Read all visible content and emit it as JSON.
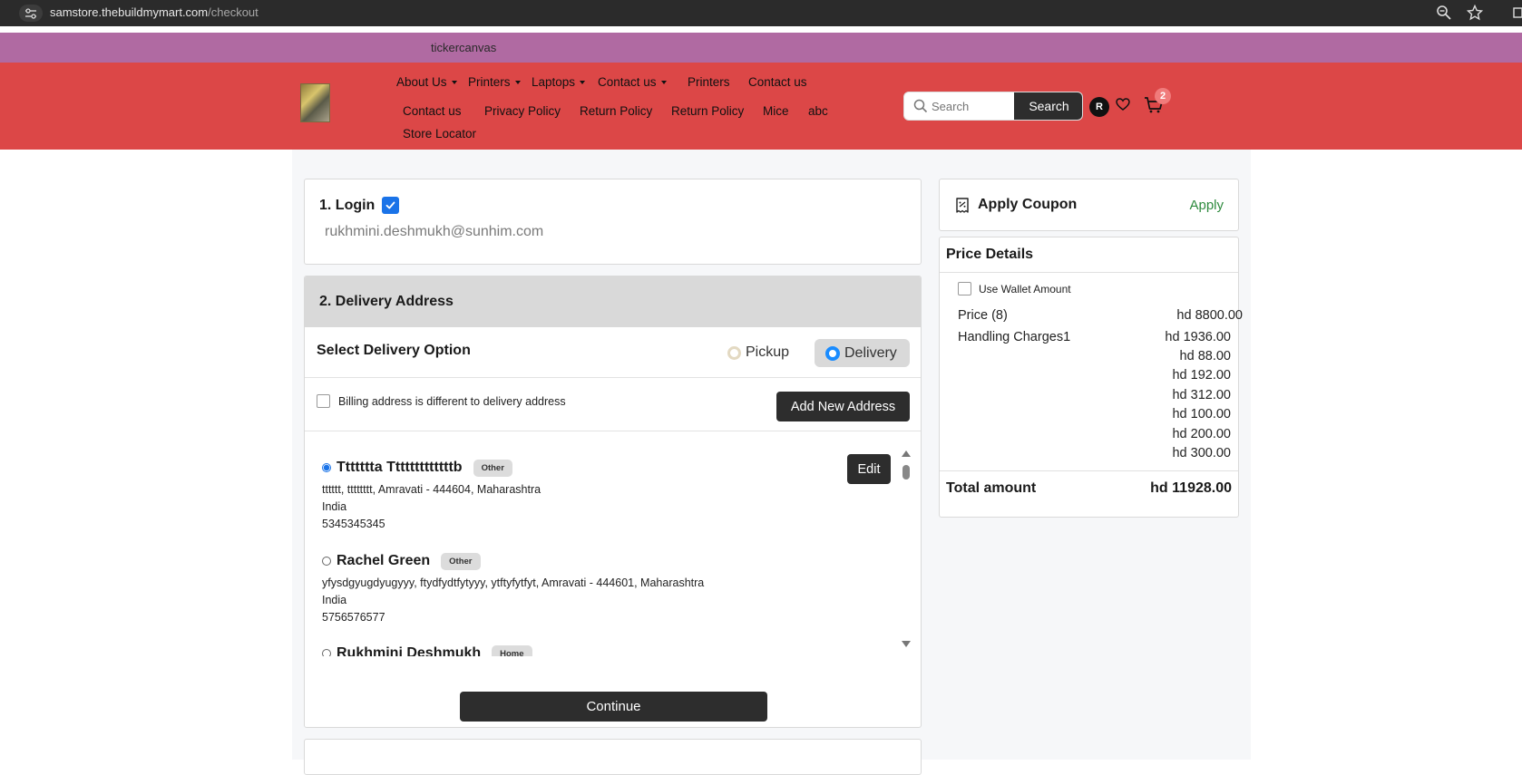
{
  "browser": {
    "url_host": "samstore.thebuildmymart.com",
    "url_path": "/checkout"
  },
  "ticker": {
    "text": "tickercanvas"
  },
  "nav": {
    "row1": [
      {
        "label": "About Us",
        "dropdown": true
      },
      {
        "label": "Printers",
        "dropdown": true
      },
      {
        "label": "Laptops",
        "dropdown": true
      },
      {
        "label": "Contact us",
        "dropdown": true
      },
      {
        "label": "Printers",
        "dropdown": false
      },
      {
        "label": "Contact us",
        "dropdown": false
      }
    ],
    "row2": [
      {
        "label": "Contact us"
      },
      {
        "label": "Privacy Policy"
      },
      {
        "label": "Return Policy"
      },
      {
        "label": "Return Policy"
      },
      {
        "label": "Mice"
      },
      {
        "label": "abc"
      }
    ],
    "row3": [
      {
        "label": "Store Locator"
      }
    ]
  },
  "search": {
    "placeholder": "Search",
    "button": "Search"
  },
  "user": {
    "initial": "R"
  },
  "cart": {
    "count": "2"
  },
  "login": {
    "title": "1. Login",
    "email": "rukhmini.deshmukh@sunhim.com"
  },
  "delivery": {
    "title": "2. Delivery Address",
    "option_title": "Select Delivery Option",
    "pickup_label": "Pickup",
    "delivery_label": "Delivery",
    "billing_label": "Billing address is different to delivery address",
    "add_button": "Add New Address",
    "edit_button": "Edit",
    "continue_button": "Continue",
    "addresses": [
      {
        "name": "Ttttttta Tttttttttttttb",
        "tag": "Other",
        "selected": true,
        "line1": "tttttt, tttttttt, Amravati - 444604, Maharashtra",
        "country": "India",
        "phone": "5345345345"
      },
      {
        "name": "Rachel Green",
        "tag": "Other",
        "selected": false,
        "line1": "yfysdgyugdyugyyy, ftydfydtfytyyy, ytftyfytfyt, Amravati - 444601, Maharashtra",
        "country": "India",
        "phone": "5756576577"
      },
      {
        "name": "Rukhmini Deshmukh",
        "tag": "Home",
        "selected": false
      }
    ]
  },
  "coupon": {
    "title": "Apply Coupon",
    "action": "Apply"
  },
  "price": {
    "title": "Price Details",
    "wallet_label": "Use Wallet Amount",
    "price_label": "Price (8)",
    "price_value": "hd 8800.00",
    "handling_label": "Handling Charges1",
    "charges": [
      "hd 1936.00",
      "hd 88.00",
      "hd 192.00",
      "hd 312.00",
      "hd 100.00",
      "hd 200.00",
      "hd 300.00"
    ],
    "total_label": "Total amount",
    "total_value": "hd 11928.00"
  },
  "colors": {
    "ticker_bg": "#b06aa2",
    "header_bg": "#dc4747",
    "dark_button": "#2d2d2d",
    "apply_green": "#2e8b3e",
    "radio_blue": "#1a8cff"
  }
}
